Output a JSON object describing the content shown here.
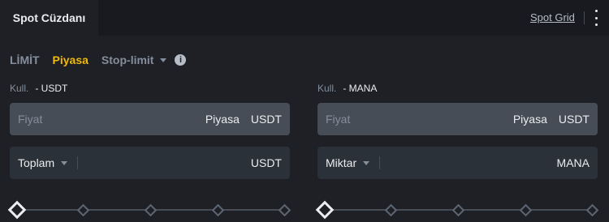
{
  "header": {
    "tab_active": "Spot Cüzdanı",
    "link": "Spot Grid",
    "menu_icon": "kebab-menu-icon"
  },
  "order_types": {
    "limit": "LİMİT",
    "market": "Piyasa",
    "stop_limit": "Stop-limit",
    "info_icon": "info-icon",
    "info_glyph": "i"
  },
  "buy": {
    "available_label": "Kull.",
    "available_value": "- USDT",
    "price_placeholder": "Fiyat",
    "price_mode": "Piyasa",
    "price_unit": "USDT",
    "amount_select": "Toplam",
    "amount_unit": "USDT",
    "slider_percent": 0
  },
  "sell": {
    "available_label": "Kull.",
    "available_value": "- MANA",
    "price_placeholder": "Fiyat",
    "price_mode": "Piyasa",
    "price_unit": "USDT",
    "amount_select": "Miktar",
    "amount_unit": "MANA",
    "slider_percent": 0
  },
  "colors": {
    "accent": "#f0b90b",
    "background": "#1e2026",
    "input_bg": "#474d57"
  }
}
